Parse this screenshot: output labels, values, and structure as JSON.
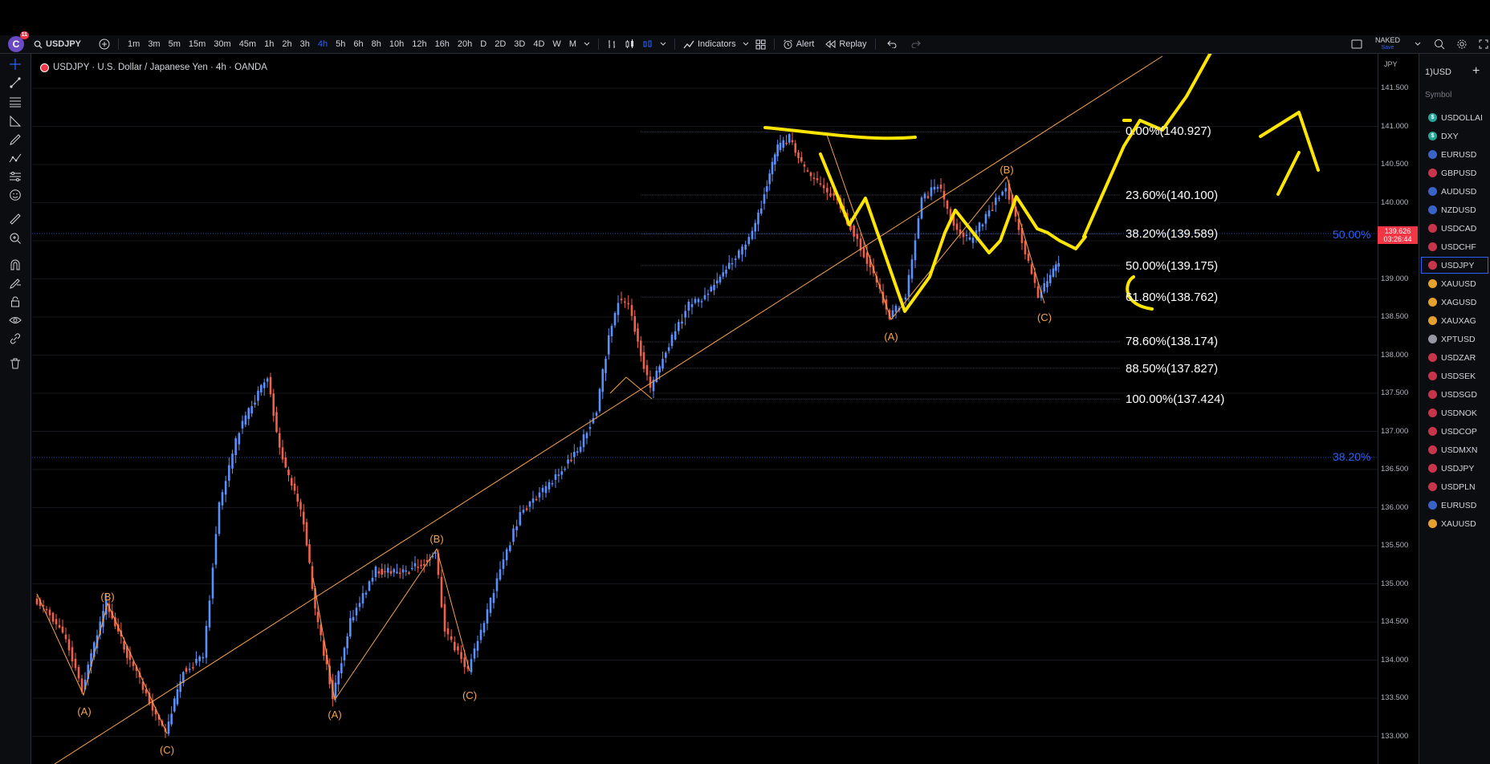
{
  "app": {
    "avatar_letter": "C",
    "notif_count": "11",
    "symbol": "USDJPY",
    "legend": "USDJPY · U.S. Dollar / Japanese Yen · 4h · OANDA",
    "layout_name": "NAKED",
    "layout_save": "Save"
  },
  "toolbar": {
    "intervals": [
      "1m",
      "3m",
      "5m",
      "15m",
      "30m",
      "45m",
      "1h",
      "2h",
      "3h",
      "4h",
      "5h",
      "6h",
      "8h",
      "10h",
      "12h",
      "16h",
      "20h",
      "D",
      "2D",
      "3D",
      "4D",
      "W",
      "M"
    ],
    "active_interval": "4h",
    "indicators_label": "Indicators",
    "alert_label": "Alert",
    "replay_label": "Replay"
  },
  "price_axis": {
    "currency": "JPY",
    "ticks": [
      "141.500",
      "141.000",
      "140.500",
      "140.000",
      "139.500",
      "139.000",
      "138.500",
      "138.000",
      "137.500",
      "137.000",
      "136.500",
      "136.000",
      "135.500",
      "135.000",
      "134.500",
      "134.000",
      "133.500",
      "133.000"
    ],
    "current_price": "139.626",
    "countdown": "03:26:44",
    "colors": {
      "current_bg": "#f23645"
    }
  },
  "fib_levels": [
    {
      "label": "0.00%(140.927)",
      "pct": "0.00%",
      "price": "140.927"
    },
    {
      "label": "23.60%(140.100)",
      "pct": "23.60%",
      "price": "140.100"
    },
    {
      "label": "38.20%(139.589)",
      "pct": "38.20%",
      "price": "139.589"
    },
    {
      "label": "50.00%(139.175)",
      "pct": "50.00%",
      "price": "139.175"
    },
    {
      "label": "61.80%(138.762)",
      "pct": "61.80%",
      "price": "138.762"
    },
    {
      "label": "78.60%(138.174)",
      "pct": "78.60%",
      "price": "138.174"
    },
    {
      "label": "88.50%(137.827)",
      "pct": "88.50%",
      "price": "137.827"
    },
    {
      "label": "100.00%(137.424)",
      "pct": "100.00%",
      "price": "137.424"
    }
  ],
  "fib_right_labels": [
    "50.00%",
    "38.20%"
  ],
  "wave_labels": [
    {
      "text": "(A)"
    },
    {
      "text": "(B)"
    },
    {
      "text": "(C)"
    },
    {
      "text": "(A)"
    },
    {
      "text": "(B)"
    },
    {
      "text": "(C)"
    },
    {
      "text": "(A)"
    },
    {
      "text": "(B)"
    },
    {
      "text": "(C)"
    }
  ],
  "watchlist": {
    "title": "1)USD",
    "column_header": "Symbol",
    "items": [
      {
        "symbol": "USDOLLAI",
        "icon": "dollar-icon",
        "color": "#26a69a"
      },
      {
        "symbol": "DXY",
        "icon": "dollar-icon",
        "color": "#26a69a"
      },
      {
        "symbol": "EURUSD",
        "icon": "flag-icon",
        "color": "#3a63c8"
      },
      {
        "symbol": "GBPUSD",
        "icon": "flag-icon",
        "color": "#c8354a"
      },
      {
        "symbol": "AUDUSD",
        "icon": "flag-icon",
        "color": "#3a63c8"
      },
      {
        "symbol": "NZDUSD",
        "icon": "flag-icon",
        "color": "#3a63c8"
      },
      {
        "symbol": "USDCAD",
        "icon": "flag-icon",
        "color": "#c8354a"
      },
      {
        "symbol": "USDCHF",
        "icon": "flag-icon",
        "color": "#c8354a"
      },
      {
        "symbol": "USDJPY",
        "icon": "flag-icon",
        "color": "#c8354a",
        "selected": true
      },
      {
        "symbol": "XAUUSD",
        "icon": "gold-icon",
        "color": "#e5a02e"
      },
      {
        "symbol": "XAGUSD",
        "icon": "silver-icon",
        "color": "#e5a02e"
      },
      {
        "symbol": "XAUXAG",
        "icon": "gold-icon",
        "color": "#e5a02e"
      },
      {
        "symbol": "XPTUSD",
        "icon": "platinum-icon",
        "color": "#9598a1"
      },
      {
        "symbol": "USDZAR",
        "icon": "flag-icon",
        "color": "#c8354a"
      },
      {
        "symbol": "USDSEK",
        "icon": "flag-icon",
        "color": "#c8354a"
      },
      {
        "symbol": "USDSGD",
        "icon": "flag-icon",
        "color": "#c8354a"
      },
      {
        "symbol": "USDNOK",
        "icon": "flag-icon",
        "color": "#c8354a"
      },
      {
        "symbol": "USDCOP",
        "icon": "flag-icon",
        "color": "#c8354a"
      },
      {
        "symbol": "USDMXN",
        "icon": "flag-icon",
        "color": "#c8354a"
      },
      {
        "symbol": "USDJPY",
        "icon": "flag-icon",
        "color": "#c8354a"
      },
      {
        "symbol": "USDPLN",
        "icon": "flag-icon",
        "color": "#c8354a"
      },
      {
        "symbol": "EURUSD",
        "icon": "flag-icon",
        "color": "#3a63c8"
      },
      {
        "symbol": "XAUUSD",
        "icon": "gold-icon",
        "color": "#e5a02e"
      }
    ]
  },
  "colors": {
    "up": "#5b8ff9",
    "down": "#f0614c",
    "wave": "#f7a24b",
    "marker": "#ffe600",
    "fib": "#2962ff"
  }
}
